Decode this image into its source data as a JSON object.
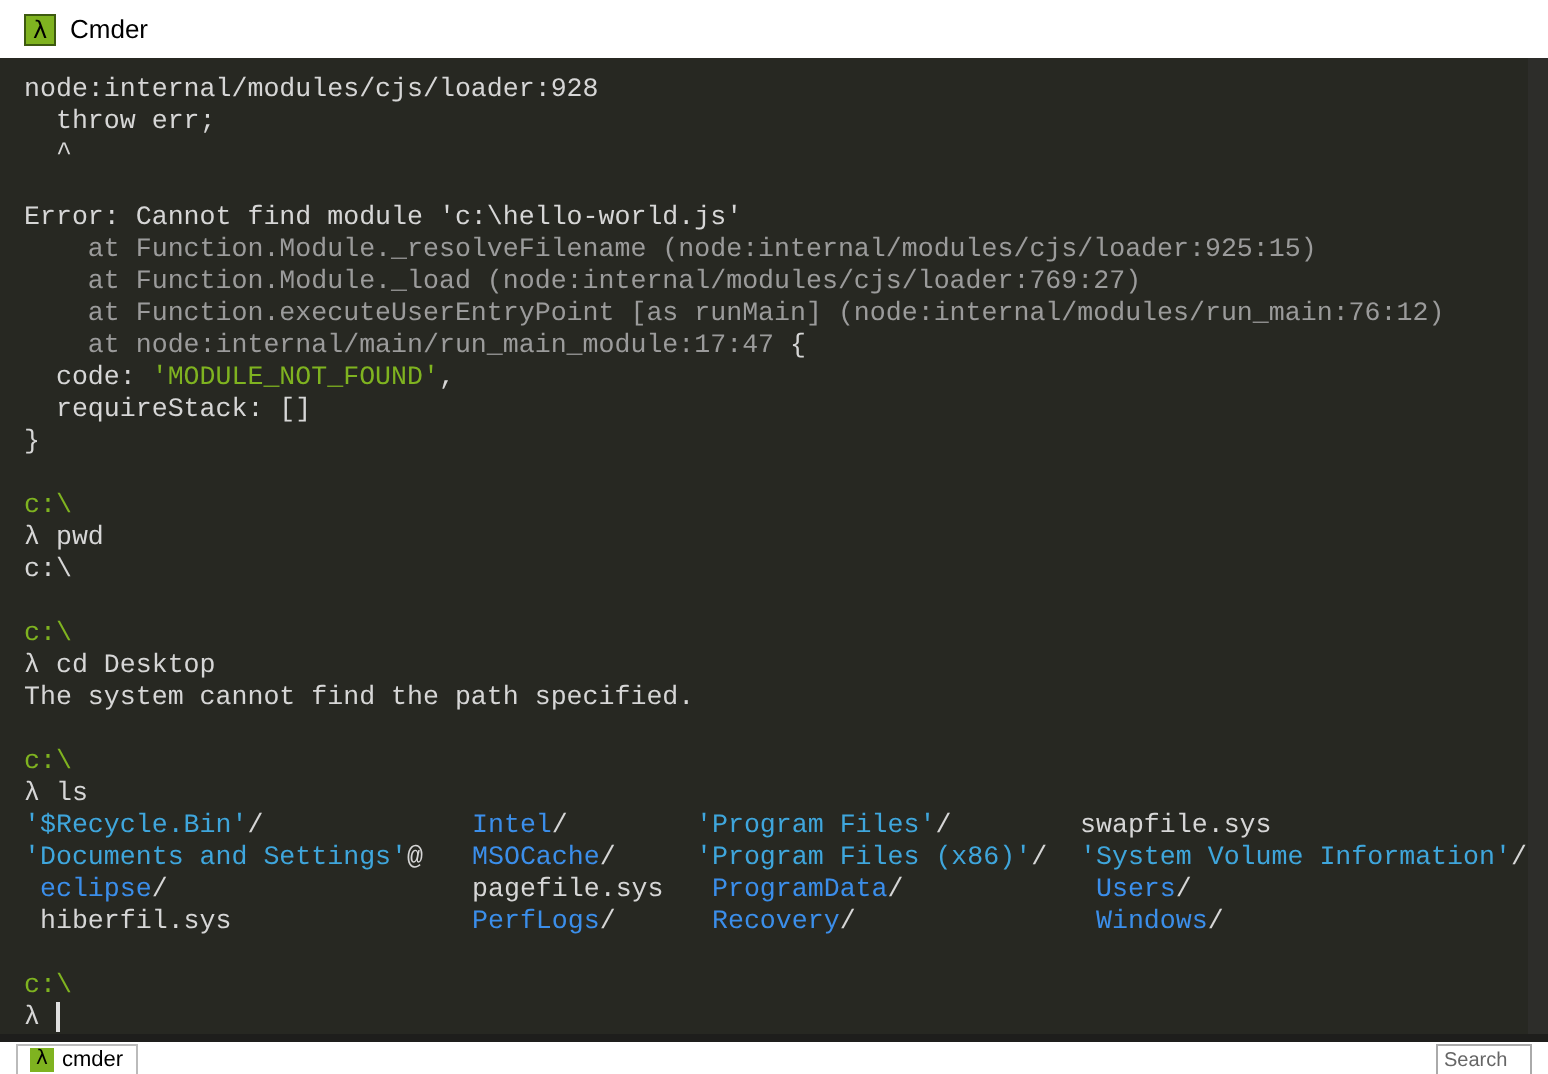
{
  "window": {
    "icon_glyph": "λ",
    "title": "Cmder"
  },
  "terminal": {
    "lines": [
      {
        "kind": "text",
        "segments": [
          {
            "kind": "plain",
            "text": "node:internal/modules/cjs/loader:928"
          }
        ]
      },
      {
        "kind": "text",
        "segments": [
          {
            "kind": "plain",
            "text": "  throw err;"
          }
        ]
      },
      {
        "kind": "text",
        "segments": [
          {
            "kind": "plain",
            "text": "  ^"
          }
        ]
      },
      {
        "kind": "blank"
      },
      {
        "kind": "text",
        "segments": [
          {
            "kind": "plain",
            "text": "Error: Cannot find module 'c:\\hello-world.js'"
          }
        ]
      },
      {
        "kind": "text",
        "segments": [
          {
            "kind": "dim",
            "text": "    at Function.Module._resolveFilename (node:internal/modules/cjs/loader:925:15)"
          }
        ]
      },
      {
        "kind": "text",
        "segments": [
          {
            "kind": "dim",
            "text": "    at Function.Module._load (node:internal/modules/cjs/loader:769:27)"
          }
        ]
      },
      {
        "kind": "text",
        "segments": [
          {
            "kind": "dim",
            "text": "    at Function.executeUserEntryPoint [as runMain] (node:internal/modules/run_main:76:12)"
          }
        ]
      },
      {
        "kind": "text",
        "segments": [
          {
            "kind": "dim",
            "text": "    at node:internal/main/run_main_module:17:47"
          },
          {
            "kind": "plain",
            "text": " {"
          }
        ]
      },
      {
        "kind": "text",
        "segments": [
          {
            "kind": "plain",
            "text": "  code: "
          },
          {
            "kind": "string",
            "text": "'MODULE_NOT_FOUND'"
          },
          {
            "kind": "plain",
            "text": ","
          }
        ]
      },
      {
        "kind": "text",
        "segments": [
          {
            "kind": "plain",
            "text": "  requireStack: []"
          }
        ]
      },
      {
        "kind": "text",
        "segments": [
          {
            "kind": "plain",
            "text": "}"
          }
        ]
      },
      {
        "kind": "blank"
      },
      {
        "kind": "text",
        "segments": [
          {
            "kind": "prompt",
            "text": "c:\\"
          }
        ]
      },
      {
        "kind": "text",
        "segments": [
          {
            "kind": "plain",
            "text": "λ pwd"
          }
        ]
      },
      {
        "kind": "text",
        "segments": [
          {
            "kind": "plain",
            "text": "c:\\"
          }
        ]
      },
      {
        "kind": "blank"
      },
      {
        "kind": "text",
        "segments": [
          {
            "kind": "prompt",
            "text": "c:\\"
          }
        ]
      },
      {
        "kind": "text",
        "segments": [
          {
            "kind": "plain",
            "text": "λ cd Desktop"
          }
        ]
      },
      {
        "kind": "text",
        "segments": [
          {
            "kind": "plain",
            "text": "The system cannot find the path specified."
          }
        ]
      },
      {
        "kind": "blank"
      },
      {
        "kind": "text",
        "segments": [
          {
            "kind": "prompt",
            "text": "c:\\"
          }
        ]
      },
      {
        "kind": "text",
        "segments": [
          {
            "kind": "plain",
            "text": "λ ls"
          }
        ]
      }
    ],
    "listing": [
      [
        {
          "kind": "quoted",
          "text": "'$Recycle.Bin'",
          "suffix": "/"
        },
        {
          "kind": "dir",
          "text": "Intel",
          "suffix": "/"
        },
        {
          "kind": "quoted",
          "text": "'Program Files'",
          "suffix": "/"
        },
        {
          "kind": "file",
          "text": "swapfile.sys"
        }
      ],
      [
        {
          "kind": "quoted",
          "text": "'Documents and Settings'",
          "suffix": "@"
        },
        {
          "kind": "dir",
          "text": "MSOCache",
          "suffix": "/"
        },
        {
          "kind": "quoted",
          "text": "'Program Files (x86)'",
          "suffix": "/"
        },
        {
          "kind": "quoted",
          "text": "'System Volume Information'",
          "suffix": "/"
        }
      ],
      [
        {
          "kind": "dir",
          "text": " eclipse",
          "suffix": "/"
        },
        {
          "kind": "file",
          "text": "pagefile.sys"
        },
        {
          "kind": "dir",
          "text": " ProgramData",
          "suffix": "/"
        },
        {
          "kind": "dir",
          "text": " Users",
          "suffix": "/"
        }
      ],
      [
        {
          "kind": "file",
          "text": " hiberfil.sys"
        },
        {
          "kind": "dir",
          "text": "PerfLogs",
          "suffix": "/"
        },
        {
          "kind": "dir",
          "text": " Recovery",
          "suffix": "/"
        },
        {
          "kind": "dir",
          "text": " Windows",
          "suffix": "/"
        }
      ]
    ],
    "after": [
      {
        "kind": "blank"
      },
      {
        "kind": "text",
        "segments": [
          {
            "kind": "prompt",
            "text": "c:\\"
          }
        ]
      },
      {
        "kind": "text",
        "segments": [
          {
            "kind": "plain",
            "text": "λ "
          }
        ],
        "cursor": true
      }
    ]
  },
  "tab_bar": {
    "tabs": [
      {
        "icon_glyph": "λ",
        "label": "cmder",
        "selected": true
      }
    ],
    "search": {
      "placeholder": "Search"
    }
  }
}
